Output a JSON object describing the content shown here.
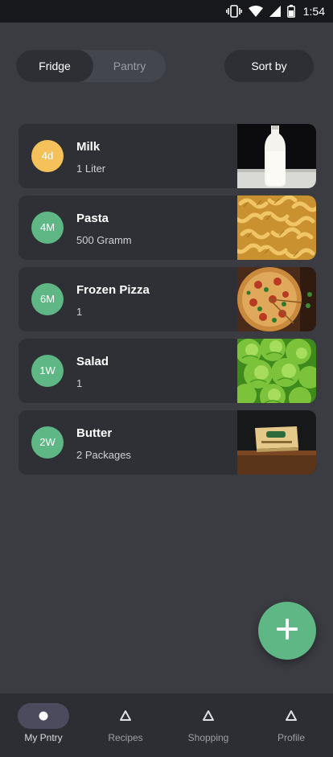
{
  "status_bar": {
    "time": "1:54",
    "icons": [
      "vibrate-icon",
      "wifi-icon",
      "signal-icon",
      "battery-icon"
    ]
  },
  "storage_tabs": {
    "options": [
      "Fridge",
      "Pantry"
    ],
    "selected": "Fridge"
  },
  "sort_button": {
    "label": "Sort by"
  },
  "items": [
    {
      "name": "Milk",
      "quantity": "1 Liter",
      "badge": "4d",
      "badge_color": "#f5c15a",
      "image": "milk-bottle-image"
    },
    {
      "name": "Pasta",
      "quantity": "500 Gramm",
      "badge": "4M",
      "badge_color": "#5fb786",
      "image": "fusilli-pasta-image"
    },
    {
      "name": "Frozen Pizza",
      "quantity": "1",
      "badge": "6M",
      "badge_color": "#5fb786",
      "image": "pizza-image"
    },
    {
      "name": "Salad",
      "quantity": "1",
      "badge": "1W",
      "badge_color": "#5fb786",
      "image": "lettuce-image"
    },
    {
      "name": "Butter",
      "quantity": "2 Packages",
      "badge": "2W",
      "badge_color": "#5fb786",
      "image": "butter-package-image"
    }
  ],
  "fab": {
    "icon": "plus-icon",
    "color": "#5fb786"
  },
  "bottom_nav": {
    "items": [
      {
        "label": "My Pntry",
        "icon": "dot-icon",
        "active": true
      },
      {
        "label": "Recipes",
        "icon": "triangle-icon",
        "active": false
      },
      {
        "label": "Shopping",
        "icon": "triangle-icon",
        "active": false
      },
      {
        "label": "Profile",
        "icon": "triangle-icon",
        "active": false
      }
    ]
  },
  "colors": {
    "background": "#3a3c42",
    "card": "#2f3035",
    "accent_green": "#5fb786",
    "accent_yellow": "#f5c15a",
    "nav_active_pill": "#4c4b5e"
  }
}
